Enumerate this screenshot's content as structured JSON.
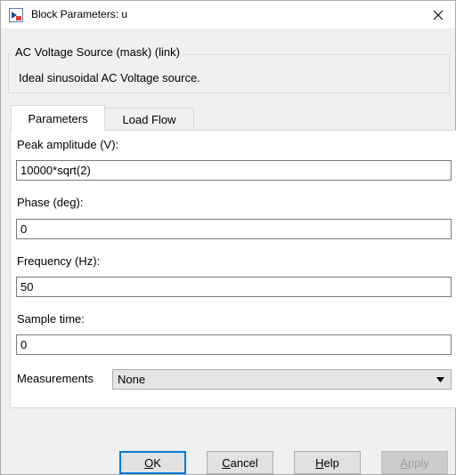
{
  "window": {
    "title": "Block Parameters: u"
  },
  "block": {
    "name": "AC Voltage Source (mask) (link)",
    "description": "Ideal sinusoidal AC Voltage source."
  },
  "tabs": [
    {
      "label": "Parameters",
      "active": true
    },
    {
      "label": "Load Flow",
      "active": false
    }
  ],
  "params": {
    "amplitude": {
      "label": "Peak amplitude (V):",
      "value": "10000*sqrt(2)"
    },
    "phase": {
      "label": "Phase (deg):",
      "value": "0"
    },
    "frequency": {
      "label": "Frequency (Hz):",
      "value": "50"
    },
    "sample_time": {
      "label": "Sample time:",
      "value": "0"
    },
    "measurements": {
      "label": "Measurements",
      "value": "None"
    }
  },
  "buttons": {
    "ok": {
      "first": "O",
      "rest": "K"
    },
    "cancel": {
      "first": "C",
      "rest": "ancel"
    },
    "help": {
      "first": "H",
      "rest": "elp"
    },
    "apply": {
      "first": "A",
      "rest": "pply"
    }
  },
  "colors": {
    "accent": "#0078d7",
    "window_bg": "#f0f0f0",
    "panel_bg": "#ffffff"
  }
}
